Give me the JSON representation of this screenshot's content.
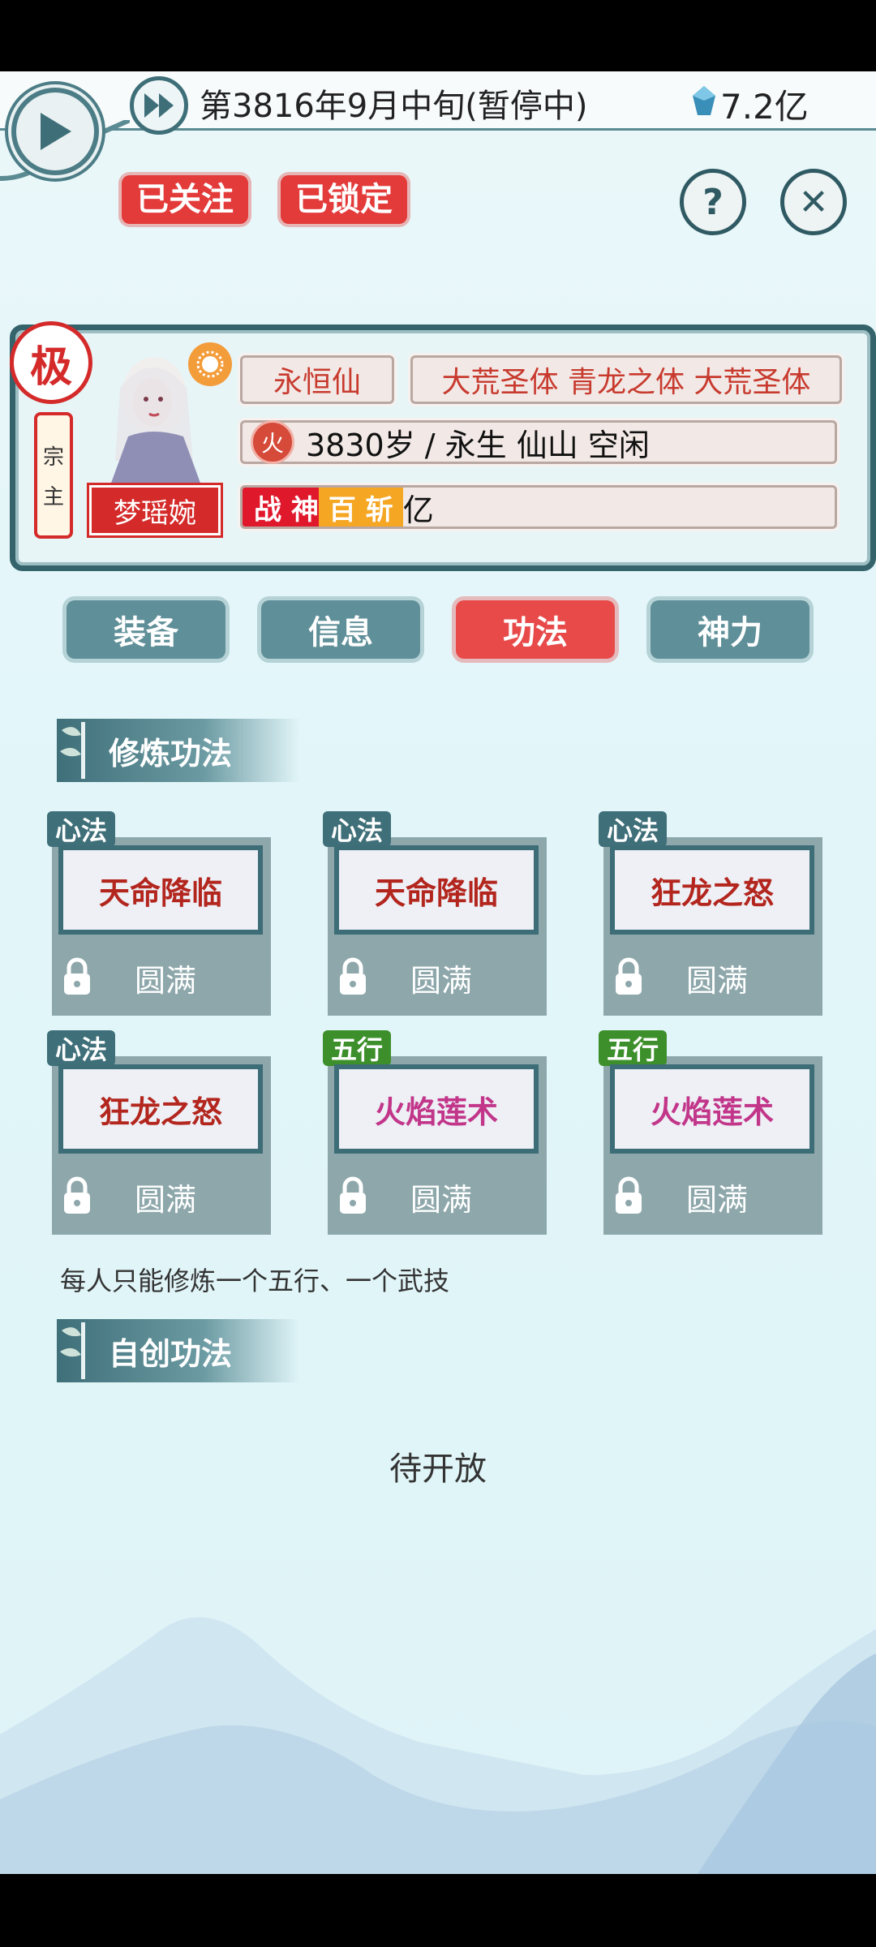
{
  "topbar": {
    "date": "第3816年9月中旬(暂停中)",
    "money": "7.2亿"
  },
  "badges": {
    "followed": "已关注",
    "locked": "已锁定"
  },
  "character": {
    "rank": "极",
    "role_chars": [
      "宗",
      "主"
    ],
    "name": "梦瑶婉",
    "title": "永恒仙",
    "bodies": "大荒圣体 青龙之体 大荒圣体",
    "element": "火",
    "age_line": "3830岁 / 永生  仙山  空闲",
    "tag_red": "战 神",
    "tag_orange": "百 斩",
    "stat_text": "亿"
  },
  "tabs": [
    {
      "label": "装备",
      "active": false
    },
    {
      "label": "信息",
      "active": false
    },
    {
      "label": "功法",
      "active": true
    },
    {
      "label": "神力",
      "active": false
    }
  ],
  "sections": {
    "cultivation": "修炼功法",
    "custom": "自创功法"
  },
  "skills": [
    {
      "type": "心法",
      "name": "天命降临",
      "level": "圆满",
      "color": "#b3261e"
    },
    {
      "type": "心法",
      "name": "天命降临",
      "level": "圆满",
      "color": "#b3261e"
    },
    {
      "type": "心法",
      "name": "狂龙之怒",
      "level": "圆满",
      "color": "#b3261e"
    },
    {
      "type": "心法",
      "name": "狂龙之怒",
      "level": "圆满",
      "color": "#b3261e"
    },
    {
      "type": "五行",
      "name": "火焰莲术",
      "level": "圆满",
      "color": "#c2368a"
    },
    {
      "type": "五行",
      "name": "火焰莲术",
      "level": "圆满",
      "color": "#c2368a"
    }
  ],
  "note": "每人只能修炼一个五行、一个武技",
  "coming_soon": "待开放"
}
